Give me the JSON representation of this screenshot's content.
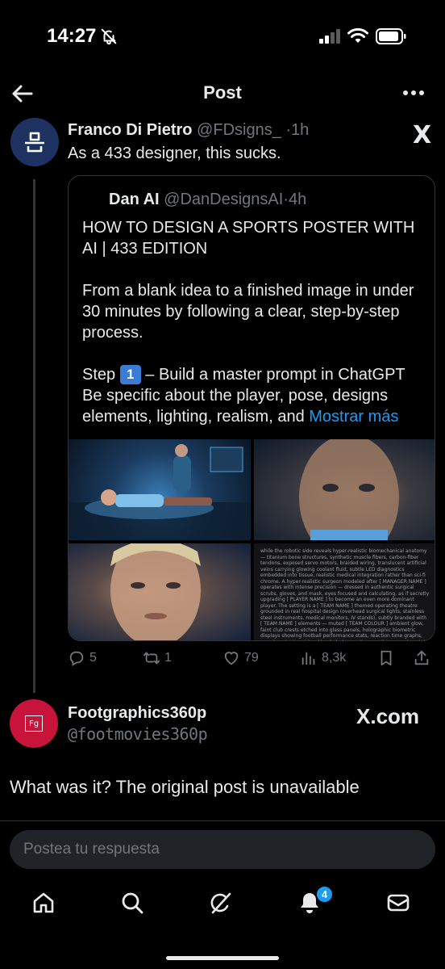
{
  "status_bar": {
    "time": "14:27",
    "icons": [
      "bell-off-icon",
      "signal-icon",
      "wifi-icon",
      "battery-icon"
    ]
  },
  "header": {
    "title": "Post",
    "back_icon": "arrow-left-icon",
    "more_icon": "more-horizontal-icon"
  },
  "post": {
    "author_name": "Franco Di Pietro",
    "author_handle": "@FDsigns_",
    "separator": "·",
    "time": "1h",
    "source_logo": "X",
    "text": "As a 433 designer, this sucks."
  },
  "quote": {
    "author_name": "Dan AI",
    "author_handle": "@DanDesignsAI",
    "separator": "·",
    "time": "4h",
    "paragraph1": "HOW TO DESIGN A SPORTS POSTER WITH AI | 433 EDITION",
    "paragraph2": "From a blank idea to a finished image in under 30 minutes by following a clear, step-by-step process.",
    "step_label": "Step",
    "step_badge": "1",
    "step_text": "– Build a master prompt in ChatGPT",
    "paragraph4": "Be specific about the player, pose, designs elements, lighting, realism, and",
    "show_more": "Mostrar más",
    "media_text": "while the robotic side reveals hyper-realistic biomechanical anatomy — titanium bone structures, synthetic muscle fibers, carbon-fiber tendons, exposed servo motors, braided wiring, translucent artificial veins carrying glowing coolant fluid, subtle LED diagnostics embedded into tissue, realistic medical integration rather than sci-fi chrome. A hyper-realistic surgeon modeled after [ MANAGER NAME ] operates with intense precision — dressed in authentic surgical scrubs, gloves, and mask, eyes focused and calculating, as if secretly upgrading [ PLAYER NAME ] to become an even more dominant player. The setting is a [ TEAM NAME ] themed operating theatre grounded in real hospital design (overhead surgical lights, stainless steel instruments, medical monitors, IV stands), subtly branded with [ TEAM NAME ] elements — muted [ TEAM COLOUR ] ambient glow, faint club crests etched into glass panels, holographic biometric displays showing football performance stats, reaction time graphs, muscle output metrics. Mood: dark, moody, secretive, experimental — like a hidden elite performance laboratory. Low-key lighting with deep shadows, dramatic rim light outlining Haaland's biomechanical form, light surgical mist in the air, cold blue highlights mixed with warm operating spotlights. Atmosphere feels forbidden and intense."
  },
  "actions": {
    "replies": "5",
    "reposts": "1",
    "likes": "79",
    "views": "8,3k"
  },
  "reply": {
    "author_name": "Footgraphics360p",
    "author_handle": "@footmovies360p",
    "source_logo": "X.com",
    "avatar_text": "Fg",
    "text": "What was it? The original post is unavailable"
  },
  "compose": {
    "placeholder": "Postea tu respuesta"
  },
  "bottom_nav": {
    "items": [
      "home-icon",
      "search-icon",
      "grok-icon",
      "notifications-icon",
      "messages-icon"
    ],
    "notification_count": "4"
  },
  "colors": {
    "background": "#000000",
    "text": "#e7e9ea",
    "secondary": "#71767b",
    "accent": "#1d9bf0",
    "franco_avatar": "#1d3261",
    "foot_avatar": "#c8133a"
  }
}
